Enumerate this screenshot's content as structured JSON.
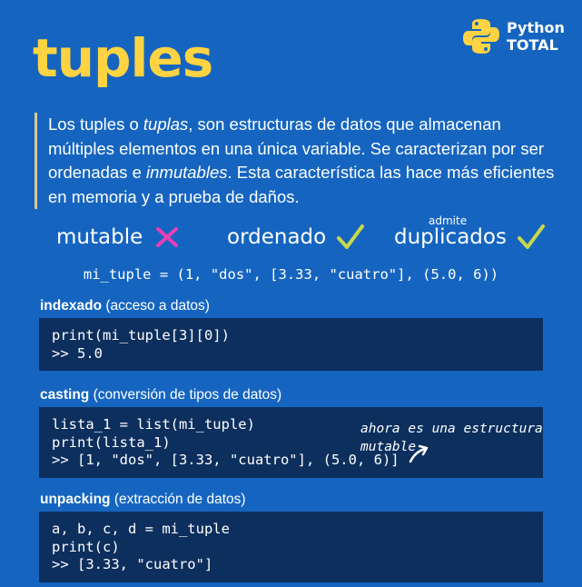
{
  "title": "tuples",
  "brand": {
    "line1": "Python",
    "line2": "TOTAL"
  },
  "intro": {
    "p1": "Los tuples o ",
    "em1": "tuplas",
    "p2": ", son estructuras de datos que almacenan múltiples elementos en una única variable. Se caracterizan por ser ordenadas e ",
    "em2": "inmutables",
    "p3": ". Esta característica las hace más eficientes en memoria y a prueba de daños."
  },
  "features": {
    "mutable": "mutable",
    "ordered": "ordenado",
    "duplicates_sup": "admite",
    "duplicates": "duplicados"
  },
  "main_code": "mi_tuple = (1, \"dos\", [3.33, \"cuatro\"], (5.0, 6))",
  "sections": [
    {
      "bold": "indexado",
      "rest": " (acceso a datos)",
      "lines": [
        "print(mi_tuple[3][0])",
        ">> 5.0"
      ]
    },
    {
      "bold": "casting",
      "rest": " (conversión de tipos de datos)",
      "lines": [
        "lista_1 = list(mi_tuple)",
        "print(lista_1)",
        ">> [1, \"dos\", [3.33, \"cuatro\"], (5.0, 6)]"
      ],
      "note": "ahora es una estructura mutable"
    },
    {
      "bold": "unpacking",
      "rest": " (extracción de datos)",
      "lines": [
        "a, b, c, d = mi_tuple",
        "print(c)",
        ">> [3.33, \"cuatro\"]"
      ]
    }
  ],
  "colors": {
    "background": "#1565c0",
    "title": "#ffd342",
    "code_bg": "#0d2f5e",
    "cross": "#e93fb4",
    "check": "#c9d84a"
  },
  "icons": {
    "brand": "python-logo-icon",
    "cross": "cross-icon",
    "check": "check-icon",
    "arrow": "curved-arrow-icon"
  }
}
